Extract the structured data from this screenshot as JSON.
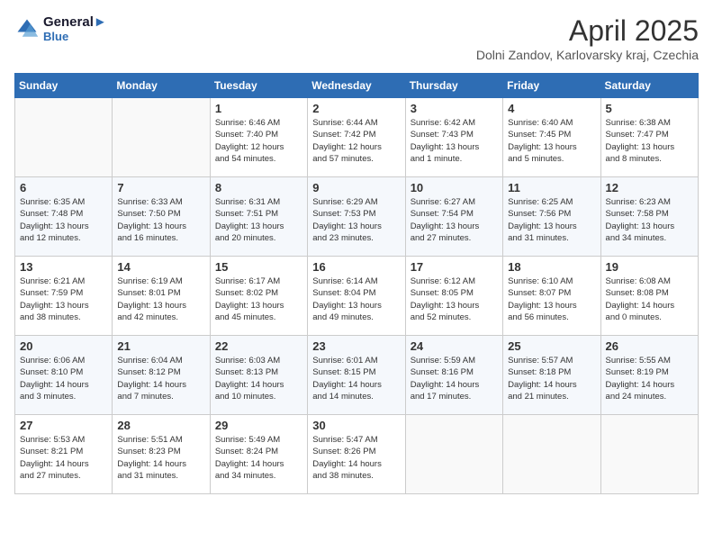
{
  "header": {
    "logo_line1": "General",
    "logo_line2": "Blue",
    "month_title": "April 2025",
    "subtitle": "Dolni Zandov, Karlovarsky kraj, Czechia"
  },
  "weekdays": [
    "Sunday",
    "Monday",
    "Tuesday",
    "Wednesday",
    "Thursday",
    "Friday",
    "Saturday"
  ],
  "weeks": [
    [
      {
        "day": "",
        "info": ""
      },
      {
        "day": "",
        "info": ""
      },
      {
        "day": "1",
        "info": "Sunrise: 6:46 AM\nSunset: 7:40 PM\nDaylight: 12 hours\nand 54 minutes."
      },
      {
        "day": "2",
        "info": "Sunrise: 6:44 AM\nSunset: 7:42 PM\nDaylight: 12 hours\nand 57 minutes."
      },
      {
        "day": "3",
        "info": "Sunrise: 6:42 AM\nSunset: 7:43 PM\nDaylight: 13 hours\nand 1 minute."
      },
      {
        "day": "4",
        "info": "Sunrise: 6:40 AM\nSunset: 7:45 PM\nDaylight: 13 hours\nand 5 minutes."
      },
      {
        "day": "5",
        "info": "Sunrise: 6:38 AM\nSunset: 7:47 PM\nDaylight: 13 hours\nand 8 minutes."
      }
    ],
    [
      {
        "day": "6",
        "info": "Sunrise: 6:35 AM\nSunset: 7:48 PM\nDaylight: 13 hours\nand 12 minutes."
      },
      {
        "day": "7",
        "info": "Sunrise: 6:33 AM\nSunset: 7:50 PM\nDaylight: 13 hours\nand 16 minutes."
      },
      {
        "day": "8",
        "info": "Sunrise: 6:31 AM\nSunset: 7:51 PM\nDaylight: 13 hours\nand 20 minutes."
      },
      {
        "day": "9",
        "info": "Sunrise: 6:29 AM\nSunset: 7:53 PM\nDaylight: 13 hours\nand 23 minutes."
      },
      {
        "day": "10",
        "info": "Sunrise: 6:27 AM\nSunset: 7:54 PM\nDaylight: 13 hours\nand 27 minutes."
      },
      {
        "day": "11",
        "info": "Sunrise: 6:25 AM\nSunset: 7:56 PM\nDaylight: 13 hours\nand 31 minutes."
      },
      {
        "day": "12",
        "info": "Sunrise: 6:23 AM\nSunset: 7:58 PM\nDaylight: 13 hours\nand 34 minutes."
      }
    ],
    [
      {
        "day": "13",
        "info": "Sunrise: 6:21 AM\nSunset: 7:59 PM\nDaylight: 13 hours\nand 38 minutes."
      },
      {
        "day": "14",
        "info": "Sunrise: 6:19 AM\nSunset: 8:01 PM\nDaylight: 13 hours\nand 42 minutes."
      },
      {
        "day": "15",
        "info": "Sunrise: 6:17 AM\nSunset: 8:02 PM\nDaylight: 13 hours\nand 45 minutes."
      },
      {
        "day": "16",
        "info": "Sunrise: 6:14 AM\nSunset: 8:04 PM\nDaylight: 13 hours\nand 49 minutes."
      },
      {
        "day": "17",
        "info": "Sunrise: 6:12 AM\nSunset: 8:05 PM\nDaylight: 13 hours\nand 52 minutes."
      },
      {
        "day": "18",
        "info": "Sunrise: 6:10 AM\nSunset: 8:07 PM\nDaylight: 13 hours\nand 56 minutes."
      },
      {
        "day": "19",
        "info": "Sunrise: 6:08 AM\nSunset: 8:08 PM\nDaylight: 14 hours\nand 0 minutes."
      }
    ],
    [
      {
        "day": "20",
        "info": "Sunrise: 6:06 AM\nSunset: 8:10 PM\nDaylight: 14 hours\nand 3 minutes."
      },
      {
        "day": "21",
        "info": "Sunrise: 6:04 AM\nSunset: 8:12 PM\nDaylight: 14 hours\nand 7 minutes."
      },
      {
        "day": "22",
        "info": "Sunrise: 6:03 AM\nSunset: 8:13 PM\nDaylight: 14 hours\nand 10 minutes."
      },
      {
        "day": "23",
        "info": "Sunrise: 6:01 AM\nSunset: 8:15 PM\nDaylight: 14 hours\nand 14 minutes."
      },
      {
        "day": "24",
        "info": "Sunrise: 5:59 AM\nSunset: 8:16 PM\nDaylight: 14 hours\nand 17 minutes."
      },
      {
        "day": "25",
        "info": "Sunrise: 5:57 AM\nSunset: 8:18 PM\nDaylight: 14 hours\nand 21 minutes."
      },
      {
        "day": "26",
        "info": "Sunrise: 5:55 AM\nSunset: 8:19 PM\nDaylight: 14 hours\nand 24 minutes."
      }
    ],
    [
      {
        "day": "27",
        "info": "Sunrise: 5:53 AM\nSunset: 8:21 PM\nDaylight: 14 hours\nand 27 minutes."
      },
      {
        "day": "28",
        "info": "Sunrise: 5:51 AM\nSunset: 8:23 PM\nDaylight: 14 hours\nand 31 minutes."
      },
      {
        "day": "29",
        "info": "Sunrise: 5:49 AM\nSunset: 8:24 PM\nDaylight: 14 hours\nand 34 minutes."
      },
      {
        "day": "30",
        "info": "Sunrise: 5:47 AM\nSunset: 8:26 PM\nDaylight: 14 hours\nand 38 minutes."
      },
      {
        "day": "",
        "info": ""
      },
      {
        "day": "",
        "info": ""
      },
      {
        "day": "",
        "info": ""
      }
    ]
  ]
}
